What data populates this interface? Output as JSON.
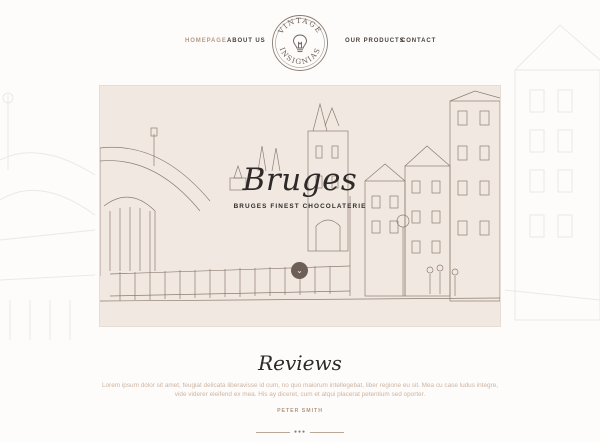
{
  "nav": {
    "items": [
      {
        "label": "HOMEPAGE",
        "active": true
      },
      {
        "label": "ABOUT US",
        "active": false
      },
      {
        "label": "OUR PRODUCTS",
        "active": false
      },
      {
        "label": "CONTACT",
        "active": false
      }
    ]
  },
  "logo": {
    "top_text": "VINTAGE",
    "bottom_text": "INSIGNIAS",
    "icon": "lightbulb-icon"
  },
  "hero": {
    "title": "Bruges",
    "subtitle": "BRUGES FINEST CHOCOLATERIE",
    "scroll_icon": "chevron-down-icon"
  },
  "reviews": {
    "title": "Reviews",
    "text": "Lorem ipsum dolor sit amet, feugiat delicata liberavisse id cum, no quo maiorum intellegebat, liber regione eu sit. Mea cu case ludus integre, vide viderer eleifend ex mea. His ay diceret, cum et atqui placerat petentium sed oporter.",
    "author": "PETER SMITH"
  },
  "colors": {
    "accent": "#b59b84",
    "text_dark": "#2f2a29",
    "hero_bg": "#f1e9e1",
    "review_text": "#cdb4a0"
  }
}
